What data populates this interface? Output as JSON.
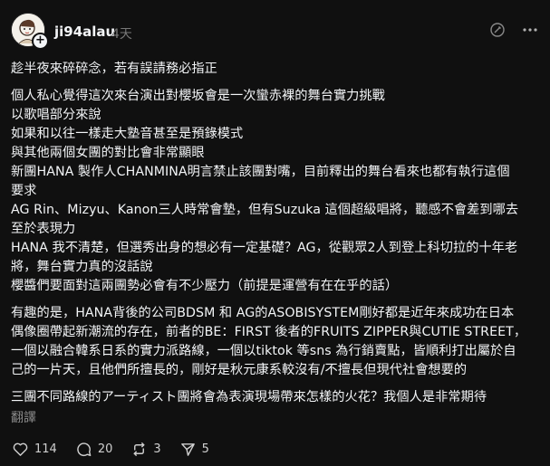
{
  "post": {
    "username": "ji94alau",
    "time": "4天",
    "paragraphs": [
      [
        "趁半夜來碎碎念，若有誤請務必指正"
      ],
      [
        "個人私心覺得這次來台演出對櫻坂會是一次蠻赤裸的舞台實力挑戰",
        "以歌唱部分來說",
        "如果和以往一樣走大塾音甚至是預錄模式",
        "與其他兩個女團的對比會非常顯眼",
        "新團HANA 製作人CHANMINA明言禁止該團對嘴，目前釋出的舞台看來也都有執行這個",
        "要求",
        "AG Rin、Mizyu、Kanon三人時常會墊，但有Suzuka 這個超級唱將，聽感不會差到哪去",
        "至於表現力",
        "HANA 我不清楚，但選秀出身的想必有一定基礎？AG，從觀眾2人到登上科切拉的十年老",
        "將，舞台實力真的沒話說",
        "櫻醬們要面對這兩團勢必會有不少壓力（前提是運營有在在乎的話）"
      ],
      [
        "有趣的是，HANA背後的公司BDSM 和 AG的ASOBISYSTEM剛好都是近年來成功在日本",
        "偶像圈帶起新潮流的存在，前者的BE：FIRST 後者的FRUITS ZIPPER與CUTIE STREET，",
        "一個以融合韓系日系的實力派路線，一個以tiktok 等sns 為行銷賣點，皆順利打出屬於自",
        "己的一片天，且他們所擅長的，剛好是秋元康系較沒有/不擅長但現代社會想要的"
      ],
      [
        "三團不同路線的アーティスト團將會為表演現場帶來怎樣的火花？我個人是非常期待"
      ]
    ],
    "translate_label": "翻譯",
    "stats": {
      "likes": "114",
      "replies": "20",
      "reposts": "3",
      "shares": "5"
    }
  }
}
